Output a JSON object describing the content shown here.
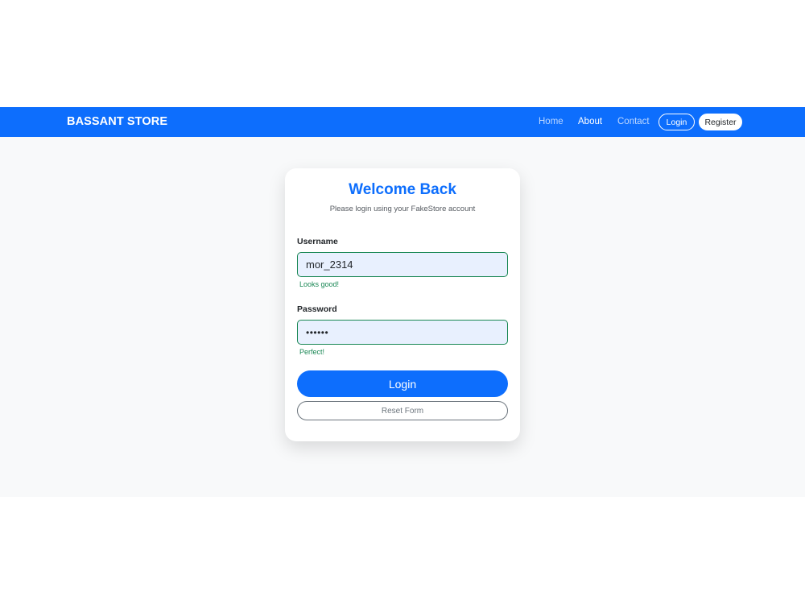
{
  "navbar": {
    "brand": "BASSANT STORE",
    "links": [
      "Home",
      "About",
      "Contact"
    ],
    "active_link": "About",
    "login_label": "Login",
    "register_label": "Register"
  },
  "card": {
    "title": "Welcome Back",
    "subtitle": "Please login using your FakeStore account",
    "username": {
      "label": "Username",
      "value": "mor_2314",
      "feedback": "Looks good!"
    },
    "password": {
      "label": "Password",
      "masked_value": "••••••",
      "feedback": "Perfect!"
    },
    "submit_label": "Login",
    "reset_label": "Reset Form"
  },
  "colors": {
    "primary": "#0d6efd",
    "success": "#198754",
    "secondary": "#6c757d",
    "input_fill": "#e8f0fe",
    "page_background": "#f8f9fa"
  }
}
